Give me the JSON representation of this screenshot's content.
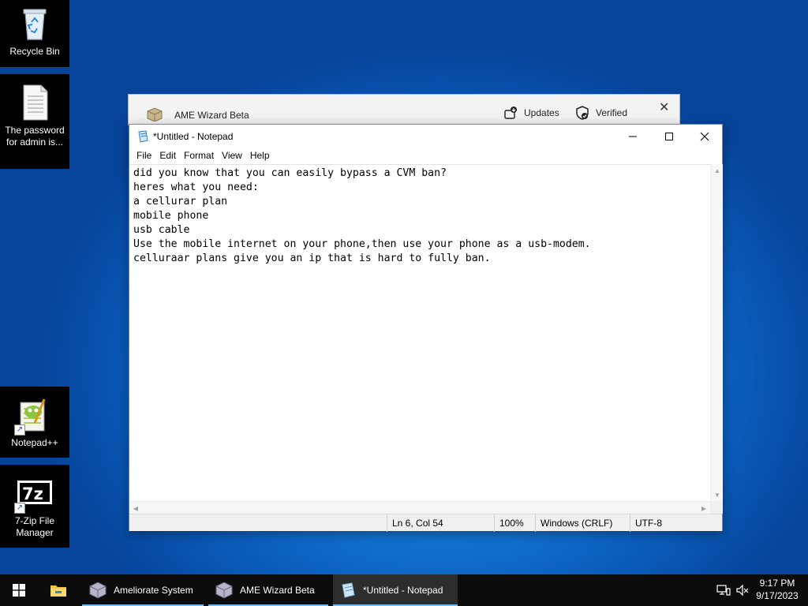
{
  "desktop": {
    "icons": [
      {
        "label": "Recycle Bin"
      },
      {
        "label": "The password for admin is..."
      },
      {
        "label": "Notepad++"
      },
      {
        "label": "7-Zip File Manager"
      }
    ]
  },
  "ame_window": {
    "title": "AME Wizard Beta",
    "updates_label": "Updates",
    "verified_label": "Verified"
  },
  "notepad": {
    "title": "*Untitled - Notepad",
    "menu": [
      "File",
      "Edit",
      "Format",
      "View",
      "Help"
    ],
    "content": "did you know that you can easily bypass a CVM ban?\nheres what you need:\na cellurar plan\nmobile phone\nusb cable\nUse the mobile internet on your phone,then use your phone as a usb-modem.\ncelluraar plans give you an ip that is hard to fully ban.",
    "status": {
      "position": "Ln 6, Col 54",
      "zoom": "100%",
      "line_ending": "Windows (CRLF)",
      "encoding": "UTF-8"
    }
  },
  "taskbar": {
    "apps": [
      {
        "label": "Ameliorate System"
      },
      {
        "label": "AME Wizard Beta"
      },
      {
        "label": "*Untitled - Notepad"
      }
    ],
    "clock": {
      "time": "9:17 PM",
      "date": "9/17/2023"
    }
  },
  "colors": {
    "desktop_accent": "#1477d6",
    "taskbar": "#0c0c0c",
    "active_underline": "#76b9ed"
  }
}
